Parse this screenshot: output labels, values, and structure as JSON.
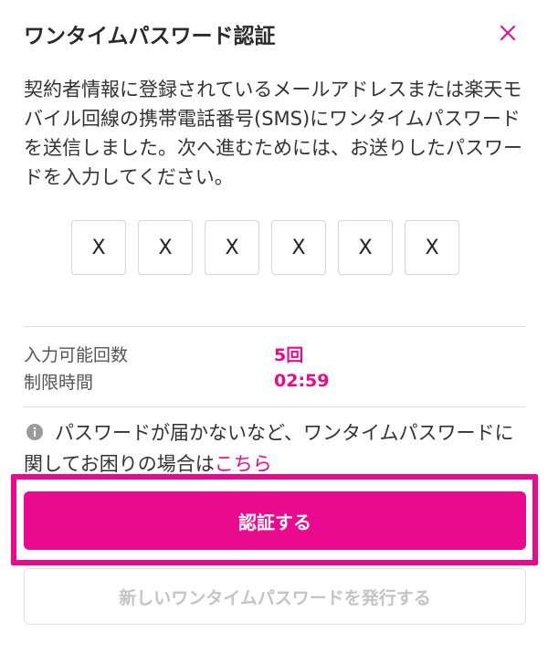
{
  "dialog": {
    "title": "ワンタイムパスワード認証",
    "close_icon": "close-icon",
    "description": "契約者情報に登録されているメールアドレスまたは楽天モバイル回線の携帯電話番号(SMS)にワンタイムパスワードを送信しました。次へ進むためには、お送りしたパスワードを入力してください。"
  },
  "otp": {
    "digits": [
      "X",
      "X",
      "X",
      "X",
      "X",
      "X"
    ]
  },
  "info": {
    "attempts_label": "入力可能回数",
    "attempts_value": "5回",
    "time_label": "制限時間",
    "time_value": "02:59"
  },
  "help": {
    "icon": "info-icon",
    "text": "パスワードが届かないなど、ワンタイムパスワードに関してお困りの場合は",
    "link_text": "こちら"
  },
  "actions": {
    "primary_label": "認証する",
    "secondary_label": "新しいワンタイムパスワードを発行する"
  },
  "colors": {
    "accent": "#ea0a8e",
    "disabled_text": "#c4c4c4",
    "divider": "#dddddd"
  }
}
